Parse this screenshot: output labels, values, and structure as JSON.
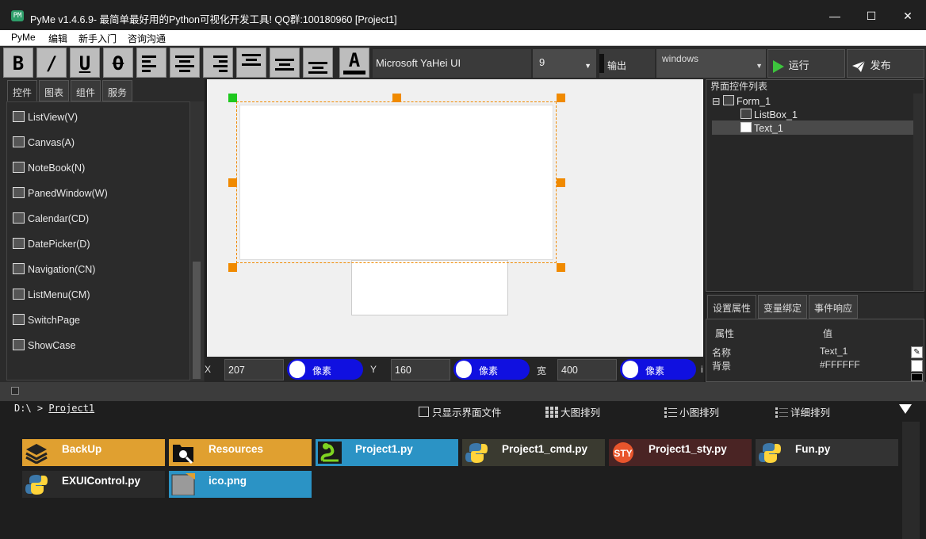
{
  "window": {
    "app_icon_text": "PM",
    "title": "PyMe v1.4.6.9- 最简单最好用的Python可视化开发工具! QQ群:100180960    [Project1]",
    "minimize": "—",
    "maximize": "☐",
    "close": "✕"
  },
  "menu": [
    "PyMe",
    "编辑",
    "新手入门",
    "咨询沟通"
  ],
  "toolbar": {
    "bold": "B",
    "italic": "/",
    "underline": "U",
    "strike": "O",
    "font_color": "A",
    "font_name": "Microsoft YaHei UI",
    "font_size": "9",
    "output_label": "输出",
    "platform": "windows",
    "run": "运行",
    "publish": "发布",
    "accent_run": "#3dc43d"
  },
  "left_tabs": [
    "控件",
    "图表",
    "组件",
    "服务"
  ],
  "controls": [
    "ListView(V)",
    "Canvas(A)",
    "NoteBook(N)",
    "PanedWindow(W)",
    "Calendar(CD)",
    "DatePicker(D)",
    "Navigation(CN)",
    "ListMenu(CM)",
    "SwitchPage",
    "ShowCase"
  ],
  "position": {
    "x_label": "X",
    "x_value": "207",
    "y_label": "Y",
    "y_value": "160",
    "w_label": "宽",
    "w_value": "400",
    "unit": "像素",
    "tail": "i"
  },
  "tree": {
    "title": "界面控件列表",
    "expander": "⊟",
    "nodes": [
      "Form_1",
      "ListBox_1",
      "Text_1"
    ],
    "selected": "Text_1"
  },
  "right_tabs": [
    "设置属性",
    "变量绑定",
    "事件响应"
  ],
  "props": {
    "col_name": "属性",
    "col_value": "值",
    "rows": [
      {
        "name": "名称",
        "value": "Text_1"
      },
      {
        "name": "背景",
        "value": "#FFFFFF"
      }
    ]
  },
  "files": {
    "path_prefix": "D:\\ >",
    "path_project": "Project1",
    "only_ui_label": "只显示界面文件",
    "view_large": "大图排列",
    "view_small": "小图排列",
    "view_detail": "详细排列",
    "items": [
      {
        "name": "BackUp",
        "color": "#e0a030"
      },
      {
        "name": "Resources",
        "color": "#e0a030"
      },
      {
        "name": "Project1.py",
        "color": "#2b93c5"
      },
      {
        "name": "Project1_cmd.py",
        "color": "#3a3a30"
      },
      {
        "name": "Project1_sty.py",
        "color": "#4a2424"
      },
      {
        "name": "Fun.py",
        "color": "#333333"
      },
      {
        "name": "EXUIControl.py",
        "color": "#2a2a2a"
      },
      {
        "name": "ico.png",
        "color": "#2b93c5"
      }
    ]
  }
}
